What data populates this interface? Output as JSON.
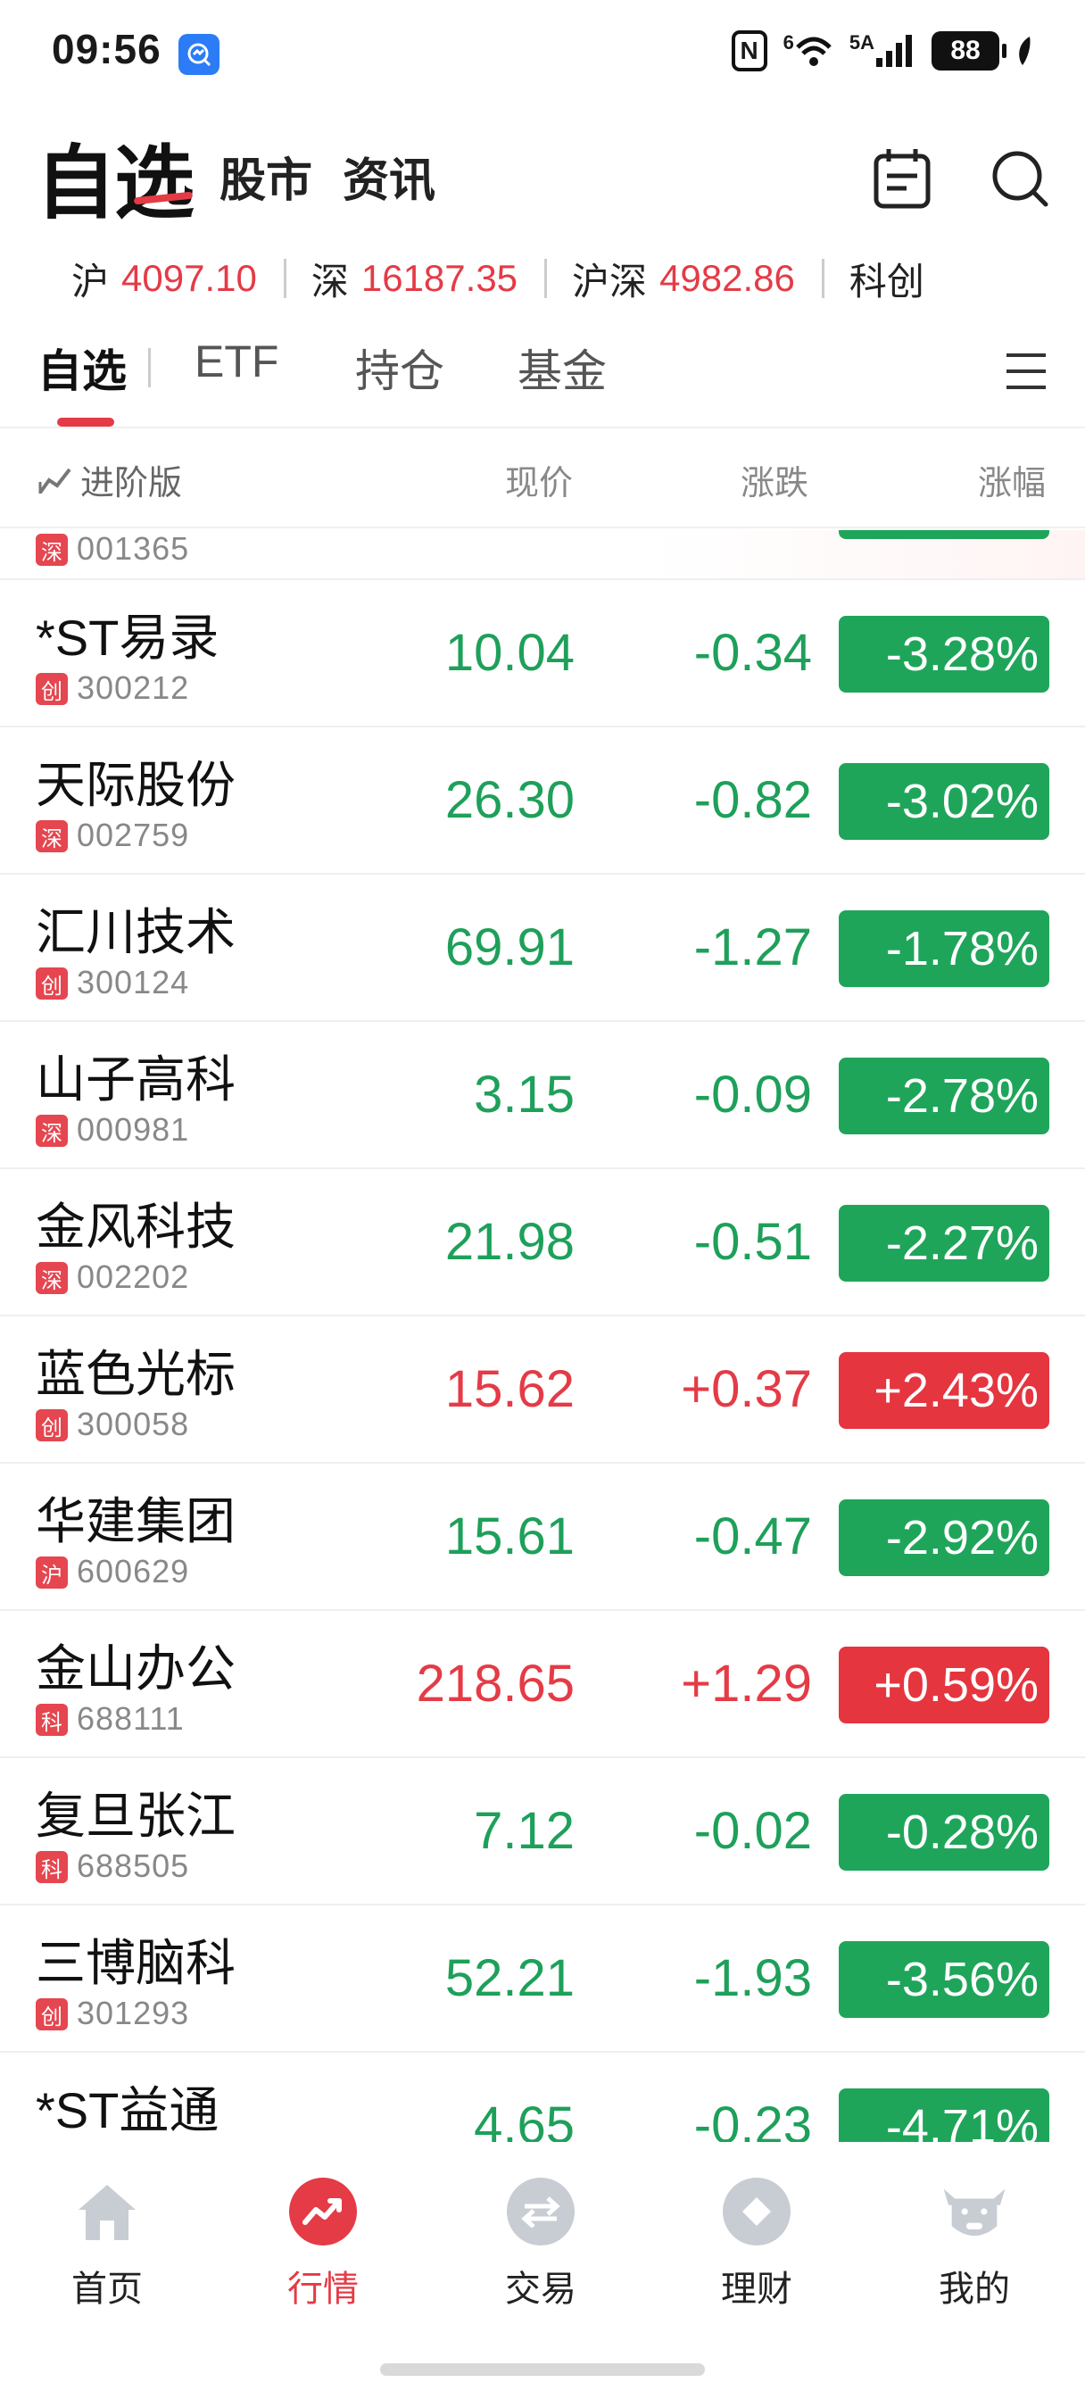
{
  "status_bar": {
    "time": "09:56",
    "network": "6",
    "network_sub": "5A",
    "battery": "88"
  },
  "header": {
    "title": "自选",
    "tabs": [
      "股市",
      "资讯"
    ]
  },
  "ticker": [
    {
      "name": "沪",
      "value": "4097.10"
    },
    {
      "name": "深",
      "value": "16187.35"
    },
    {
      "name": "沪深",
      "value": "4982.86"
    },
    {
      "name": "科创",
      "value": ""
    }
  ],
  "category_tabs": {
    "items": [
      "自选",
      "ETF",
      "持仓",
      "基金"
    ],
    "active": 0
  },
  "columns": {
    "advanced": "进阶版",
    "price": "现价",
    "change": "涨跌",
    "change_pct": "涨幅"
  },
  "colors": {
    "up": "#e43b46",
    "down": "#1ea05a"
  },
  "partial_row": {
    "badge": "深",
    "code": "001365"
  },
  "stocks": [
    {
      "name": "*ST易录",
      "badge": "创",
      "code": "300212",
      "price": "10.04",
      "change": "-0.34",
      "pct": "-3.28%",
      "dir": "down"
    },
    {
      "name": "天际股份",
      "badge": "深",
      "code": "002759",
      "price": "26.30",
      "change": "-0.82",
      "pct": "-3.02%",
      "dir": "down"
    },
    {
      "name": "汇川技术",
      "badge": "创",
      "code": "300124",
      "price": "69.91",
      "change": "-1.27",
      "pct": "-1.78%",
      "dir": "down"
    },
    {
      "name": "山子高科",
      "badge": "深",
      "code": "000981",
      "price": "3.15",
      "change": "-0.09",
      "pct": "-2.78%",
      "dir": "down"
    },
    {
      "name": "金风科技",
      "badge": "深",
      "code": "002202",
      "price": "21.98",
      "change": "-0.51",
      "pct": "-2.27%",
      "dir": "down"
    },
    {
      "name": "蓝色光标",
      "badge": "创",
      "code": "300058",
      "price": "15.62",
      "change": "+0.37",
      "pct": "+2.43%",
      "dir": "up"
    },
    {
      "name": "华建集团",
      "badge": "沪",
      "code": "600629",
      "price": "15.61",
      "change": "-0.47",
      "pct": "-2.92%",
      "dir": "down"
    },
    {
      "name": "金山办公",
      "badge": "科",
      "code": "688111",
      "price": "218.65",
      "change": "+1.29",
      "pct": "+0.59%",
      "dir": "up"
    },
    {
      "name": "复旦张江",
      "badge": "科",
      "code": "688505",
      "price": "7.12",
      "change": "-0.02",
      "pct": "-0.28%",
      "dir": "down"
    },
    {
      "name": "三博脑科",
      "badge": "创",
      "code": "301293",
      "price": "52.21",
      "change": "-1.93",
      "pct": "-3.56%",
      "dir": "down"
    },
    {
      "name": "*ST益通",
      "badge": "",
      "code": "",
      "price": "4.65",
      "change": "-0.23",
      "pct": "-4.71%",
      "dir": "down"
    }
  ],
  "bottom_nav": {
    "items": [
      {
        "label": "首页",
        "icon": "home-icon"
      },
      {
        "label": "行情",
        "icon": "market-trend-icon"
      },
      {
        "label": "交易",
        "icon": "trade-exchange-icon"
      },
      {
        "label": "理财",
        "icon": "wealth-diamond-icon"
      },
      {
        "label": "我的",
        "icon": "profile-bull-icon"
      }
    ],
    "active": 1
  }
}
